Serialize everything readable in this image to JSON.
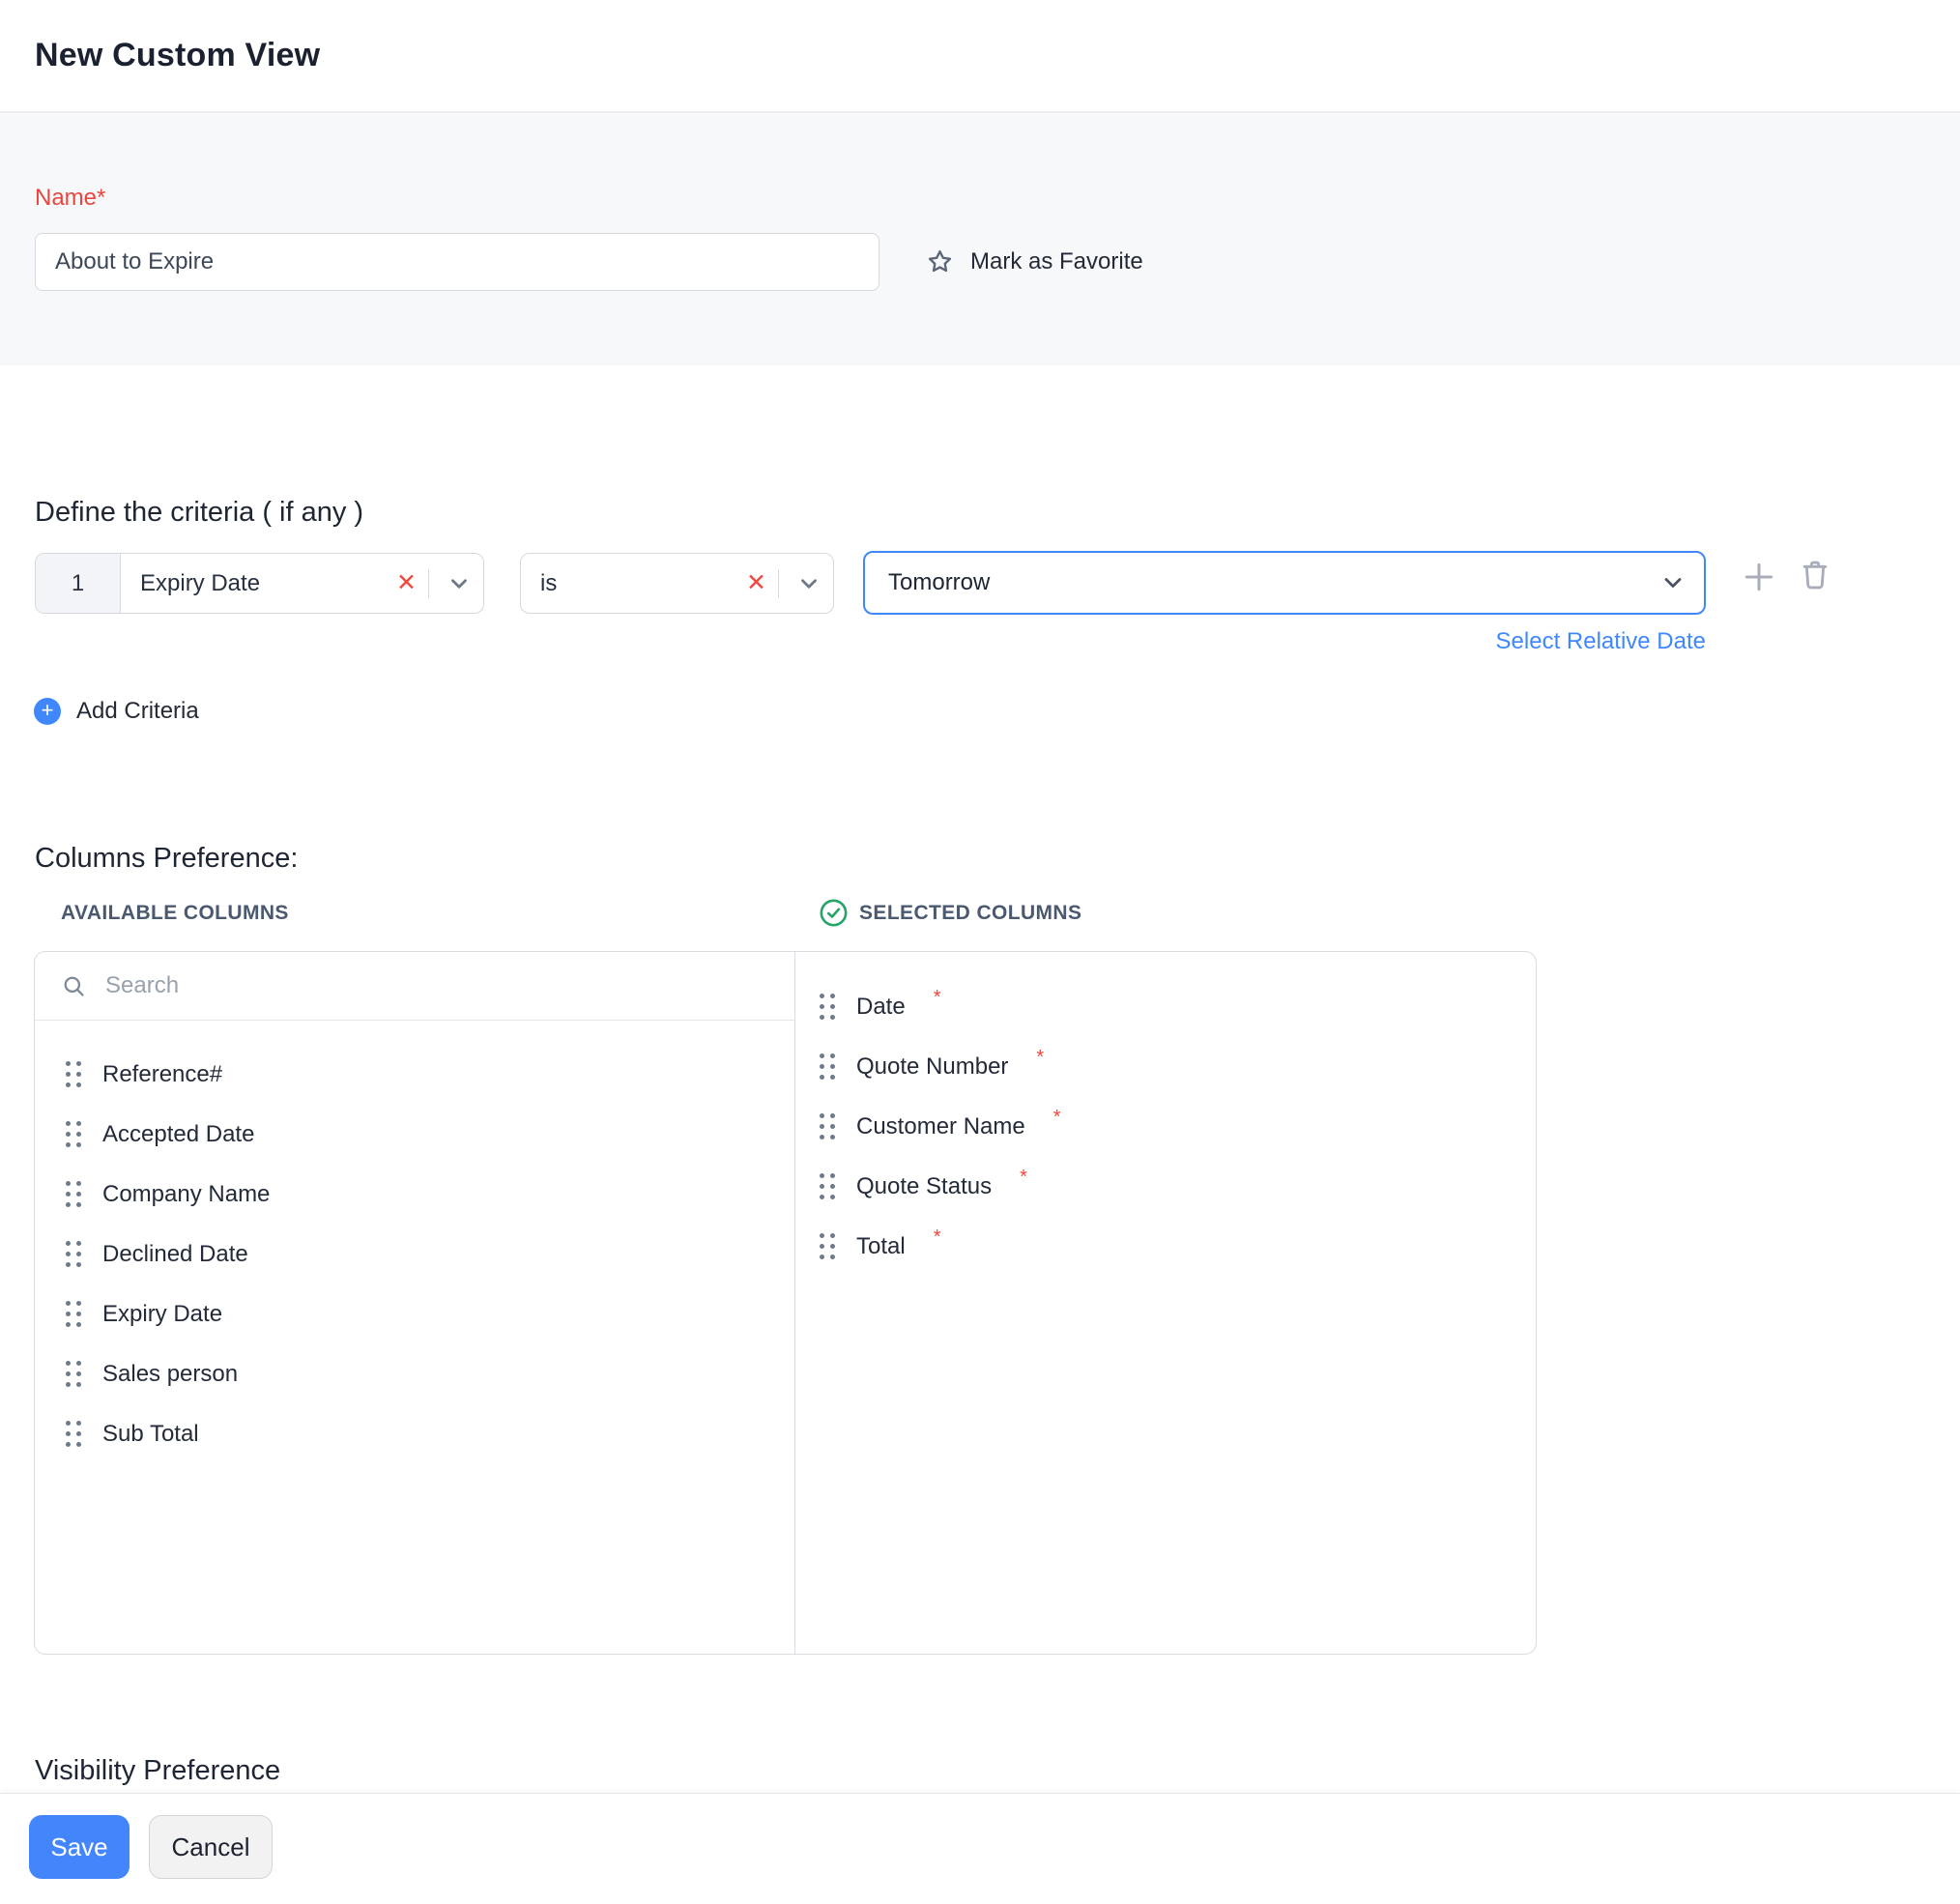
{
  "page": {
    "title": "New Custom View"
  },
  "name_form": {
    "label": "Name*",
    "value": "About to Expire",
    "favorite": "Mark as Favorite"
  },
  "criteria": {
    "heading": "Define the criteria ( if any )",
    "row_index": "1",
    "field": "Expiry Date",
    "operator": "is",
    "value": "Tomorrow",
    "remove_glyph": "✕",
    "relative_date_link": "Select Relative Date",
    "add_label": "Add Criteria"
  },
  "columns": {
    "heading": "Columns Preference:",
    "available_header": "AVAILABLE COLUMNS",
    "selected_header": "SELECTED COLUMNS",
    "search_placeholder": "Search",
    "available": [
      "Reference#",
      "Accepted Date",
      "Company Name",
      "Declined Date",
      "Expiry Date",
      "Sales person",
      "Sub Total"
    ],
    "selected": [
      "Date",
      "Quote Number",
      "Customer Name",
      "Quote Status",
      "Total"
    ],
    "required_marker": "*"
  },
  "visibility": {
    "heading": "Visibility Preference"
  },
  "footer": {
    "save": "Save",
    "cancel": "Cancel"
  },
  "colors": {
    "accent_blue": "#3f87fa",
    "danger_red": "#f0483e",
    "success_green": "#27a46a",
    "band_gray": "#f7f8fa"
  }
}
